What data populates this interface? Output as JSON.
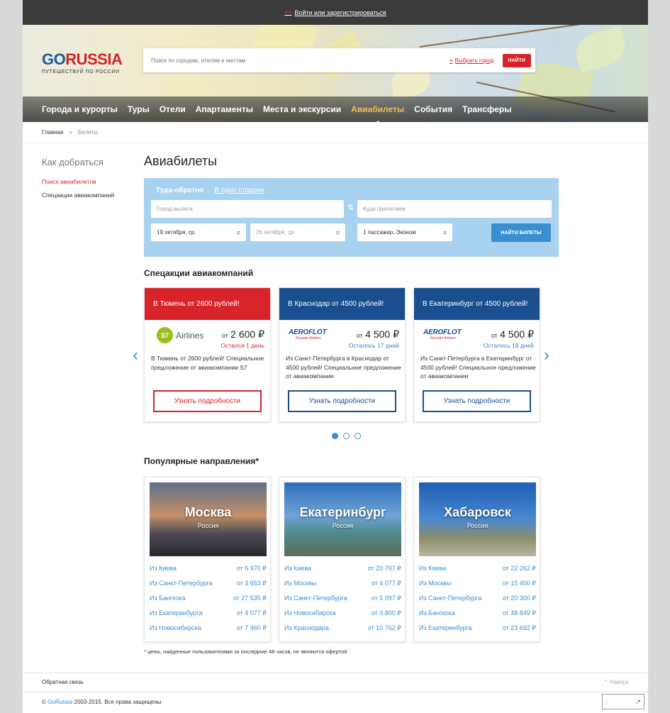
{
  "topbar": {
    "login_label": "Войти или зарегистрироваться"
  },
  "header": {
    "logo_go": "GO",
    "logo_russia": "RUSSIA",
    "logo_sub": "ПУТЕШЕСТВУЙ ПО РОССИИ",
    "search_placeholder": "Поиск по городам, отелям и местам",
    "choose_city": "Выбрать город",
    "search_button": "НАЙТИ"
  },
  "nav": {
    "items": [
      {
        "label": "Города и курорты"
      },
      {
        "label": "Туры"
      },
      {
        "label": "Отели"
      },
      {
        "label": "Апартаменты"
      },
      {
        "label": "Места и экскурсии"
      },
      {
        "label": "Авиабилеты"
      },
      {
        "label": "События"
      },
      {
        "label": "Трансферы"
      }
    ],
    "active": "Авиабилеты"
  },
  "breadcrumb": {
    "home": "Главная",
    "sep": "»",
    "current": "Билеты"
  },
  "sidebar": {
    "title": "Как добраться",
    "links": [
      {
        "label": "Поиск авиабилетов"
      },
      {
        "label": "Спецакции авиакомпаний"
      }
    ]
  },
  "main": {
    "title": "Авиабилеты",
    "booking": {
      "tab_roundtrip": "Туда-обратно",
      "tab_oneway": "В одну сторону",
      "from_placeholder": "Город вылета",
      "to_placeholder": "Куда прилетаем",
      "date_there": "19 октября, ср",
      "date_back": "26 октября, ср",
      "passengers": "1 пассажир, Эконом",
      "find_button": "НАЙТИ БИЛЕТЫ"
    },
    "promos_title": "Спецакции авиакомпаний",
    "promos": [
      {
        "head": "В Тюмень от 2600 рублей!",
        "airline": "Airlines",
        "airline_mark": "S7",
        "from": "от",
        "price": "2 600 ₽",
        "left": "Остался 1 день",
        "desc": "В Тюмень от 2600 рублей! Специальное предложение от авиакомпании S7",
        "more": "Узнать подробности"
      },
      {
        "head": "В Краснодар от 4500 рублей!",
        "airline": "AEROFLOT",
        "airline_sub": "Russian Airlines",
        "from": "от",
        "price": "4 500 ₽",
        "left": "Осталось 17 дней",
        "desc": "Из Санкт-Петербурга в Краснодар от 4500 рублей! Специальное предложение от авиакомпании",
        "more": "Узнать подробности"
      },
      {
        "head": "В Екатеринбург от 4500 рублей!",
        "airline": "AEROFLOT",
        "airline_sub": "Russian Airlines",
        "from": "от",
        "price": "4 500 ₽",
        "left": "Осталось 18 дней",
        "desc": "Из Санкт-Петербурга в Екатеринбург от 4500 рублей! Специальное предложение от авиакомпании",
        "more": "Узнать подробности"
      }
    ],
    "popular_title": "Популярные направления*",
    "destinations": [
      {
        "city": "Москва",
        "country": "Россия",
        "routes": [
          {
            "from": "Из Киева",
            "price": "от 6 970 ₽"
          },
          {
            "from": "Из Санкт-Петербурга",
            "price": "от 3 653 ₽"
          },
          {
            "from": "Из Бангкока",
            "price": "от 27 535 ₽"
          },
          {
            "from": "Из Екатеринбурга",
            "price": "от 4 077 ₽"
          },
          {
            "from": "Из Новосибирска",
            "price": "от 7 960 ₽"
          }
        ]
      },
      {
        "city": "Екатеринбург",
        "country": "Россия",
        "routes": [
          {
            "from": "Из Киева",
            "price": "от 20 797 ₽"
          },
          {
            "from": "Из Москвы",
            "price": "от 4 077 ₽"
          },
          {
            "from": "Из Санкт-Петербурга",
            "price": "от 5 097 ₽"
          },
          {
            "from": "Из Новосибирска",
            "price": "от 3 800 ₽"
          },
          {
            "from": "Из Краснодара",
            "price": "от 10 762 ₽"
          }
        ]
      },
      {
        "city": "Хабаровск",
        "country": "Россия",
        "routes": [
          {
            "from": "Из Киева",
            "price": "от 22 262 ₽"
          },
          {
            "from": "Из Москвы",
            "price": "от 15 400 ₽"
          },
          {
            "from": "Из Санкт-Петербурга",
            "price": "от 20 300 ₽"
          },
          {
            "from": "Из Бангкока",
            "price": "от 48 849 ₽"
          },
          {
            "from": "Из Екатеринбурга",
            "price": "от 23 692 ₽"
          }
        ]
      }
    ],
    "footnote": "* цены, найденные пользователями за последние 48 часов, не являются офертой"
  },
  "footer": {
    "feedback": "Обратная связь",
    "up": "Наверх",
    "copy_prefix": "©",
    "copy_brand": "GoRussia",
    "copy_text": "2003-2015. Все права защищены"
  },
  "colors": {
    "brand_red": "#d8232a",
    "brand_blue": "#1a4e8f",
    "accent_blue": "#3a8fd1",
    "nav_active": "#f2c14e"
  }
}
